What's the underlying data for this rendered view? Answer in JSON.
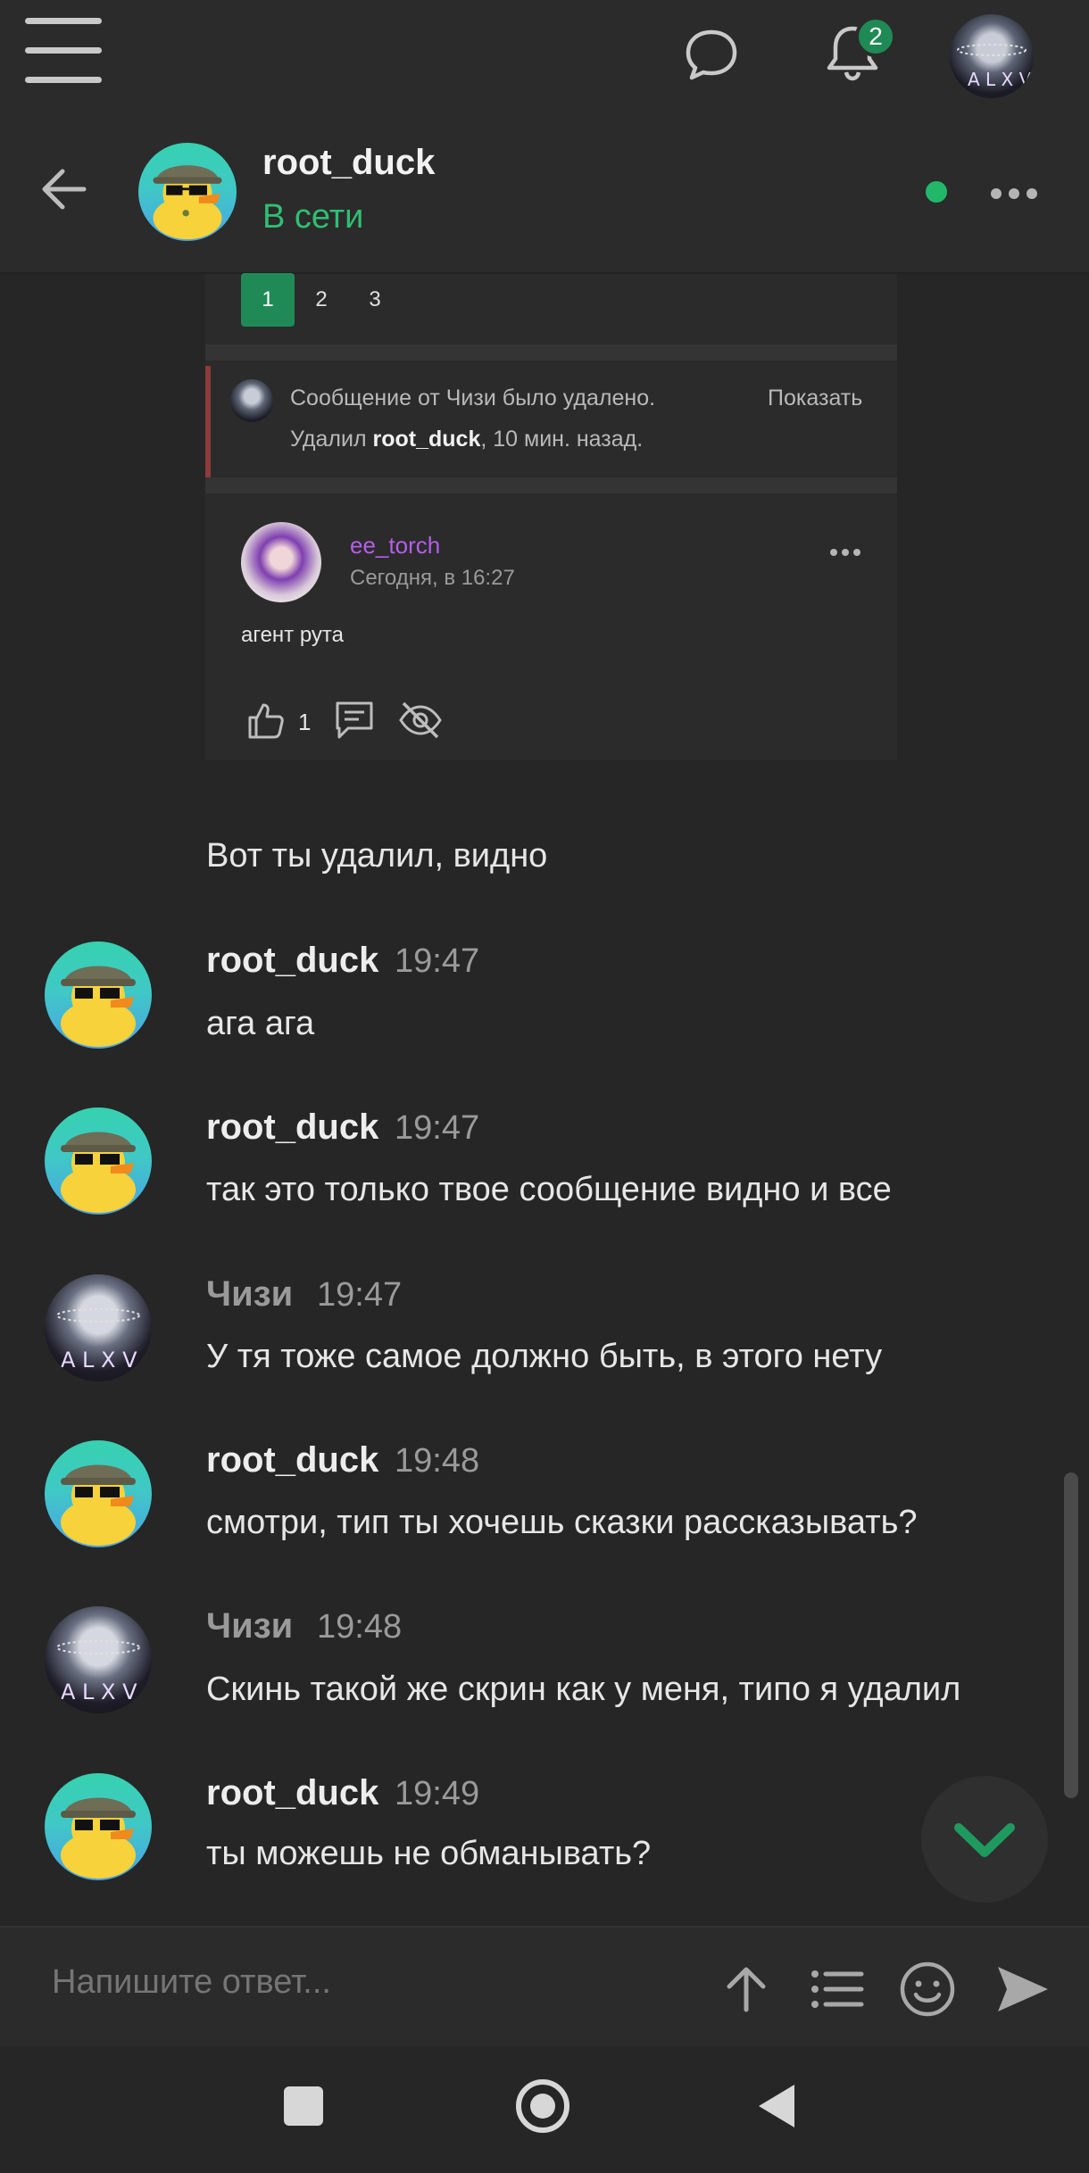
{
  "topbar": {
    "notification_count": "2"
  },
  "chat_header": {
    "name": "root_duck",
    "status": "В сети",
    "status_color": "#2fbf71"
  },
  "quote": {
    "pages": [
      "1",
      "2",
      "3"
    ],
    "active_page": "1",
    "deleted_notice": "Сообщение от Чизи было удалено.",
    "deleted_by_prefix": "Удалил ",
    "deleted_by_user": "root_duck",
    "deleted_by_suffix": ", 10 мин. назад.",
    "show_label": "Показать",
    "post": {
      "author": "ee_torch",
      "time": "Сегодня, в 16:27",
      "body": "агент рута",
      "likes": "1"
    }
  },
  "messages": [
    {
      "text": "Вот ты удалил, видно"
    },
    {
      "author": "root_duck",
      "time": "19:47",
      "text": "ага ага"
    },
    {
      "author": "root_duck",
      "time": "19:47",
      "text": "так это только твое сообщение видно и все"
    },
    {
      "author": "Чизи",
      "time": "19:47",
      "text": "У тя тоже самое должно быть, в этого нету"
    },
    {
      "author": "root_duck",
      "time": "19:48",
      "text": "смотри, тип ты хочешь сказки рассказывать?"
    },
    {
      "author": "Чизи",
      "time": "19:48",
      "text": "Скинь такой же скрин как у меня, типо я удалил"
    },
    {
      "author": "root_duck",
      "time": "19:49",
      "text": "ты можешь не обманывать?"
    }
  ],
  "composer": {
    "placeholder": "Напишите ответ..."
  },
  "colors": {
    "accent": "#1f8a55",
    "background": "#262626",
    "panel": "#2b2b2b"
  }
}
